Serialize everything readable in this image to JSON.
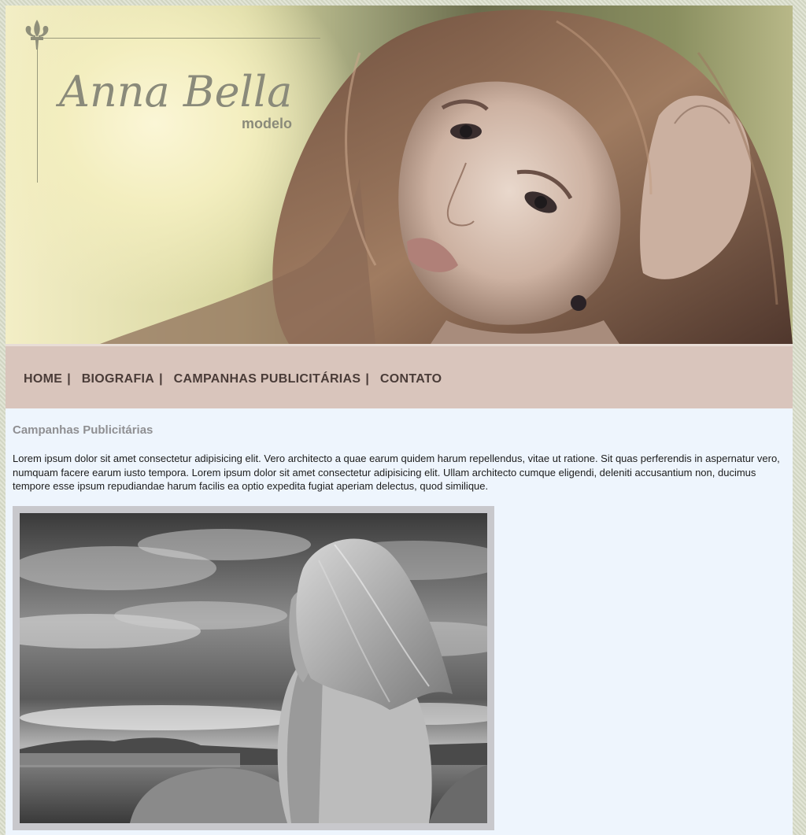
{
  "header": {
    "logo_title": "Anna Bella",
    "logo_subtitle": "modelo"
  },
  "nav": {
    "items": [
      {
        "label": "HOME"
      },
      {
        "label": "BIOGRAFIA"
      },
      {
        "label": "CAMPANHAS PUBLICITÁRIAS"
      },
      {
        "label": "CONTATO"
      }
    ],
    "separator": "|"
  },
  "main": {
    "heading": "Campanhas Publicitárias",
    "paragraph": "Lorem ipsum dolor sit amet consectetur adipisicing elit. Vero architecto a quae earum quidem harum repellendus, vitae ut ratione. Sit quas perferendis in aspernatur vero, numquam facere earum iusto tempora. Lorem ipsum dolor sit amet consectetur adipisicing elit. Ullam architecto cumque eligendi, deleniti accusantium non, ducimus tempore esse ipsum repudiandae harum facilis ea optio expedita fugiat aperiam delectus, quod similique."
  },
  "colors": {
    "nav_background": "#d9c5bc",
    "content_background": "#eef5fd",
    "nav_text": "#4a3c38",
    "heading_text": "#8f8f92"
  }
}
